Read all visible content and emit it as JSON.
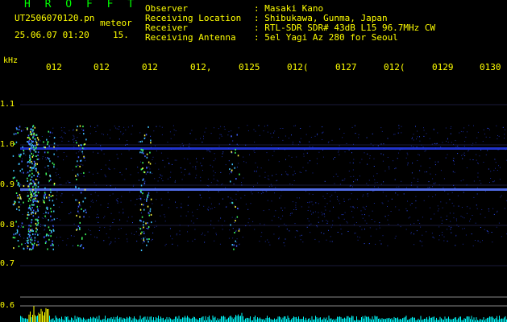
{
  "header": {
    "app_name": "H R O F F T",
    "filename": "UT2506070120.pn",
    "filename_suffix": "meteor",
    "datetime": "25.06.07 01:20",
    "extra_value": "15."
  },
  "info": [
    {
      "label": "Observer",
      "value": ": Masaki Kano"
    },
    {
      "label": "Receiving Location",
      "value": ": Shibukawa, Gunma, Japan"
    },
    {
      "label": "Receiver",
      "value": ": RTL-SDR SDR# 43dB L15 96.7MHz CW"
    },
    {
      "label": "Receiving Antenna",
      "value": ": 5el Yagi Az 280 for Seoul"
    }
  ],
  "axis": {
    "unit": "kHz",
    "y_labels": [
      "1.1",
      "1.0",
      "0.9",
      "0.8",
      "0.7",
      "0.6"
    ],
    "time_ticks": [
      "012",
      "012",
      "012",
      "012,",
      "0125",
      "012(",
      "0127",
      "012(",
      "0129",
      "0130"
    ]
  },
  "colors": {
    "text": "#ffff00",
    "title": "#00ff00",
    "background": "#000000",
    "trace": "#00ffff",
    "echo": "#3050ff"
  }
}
